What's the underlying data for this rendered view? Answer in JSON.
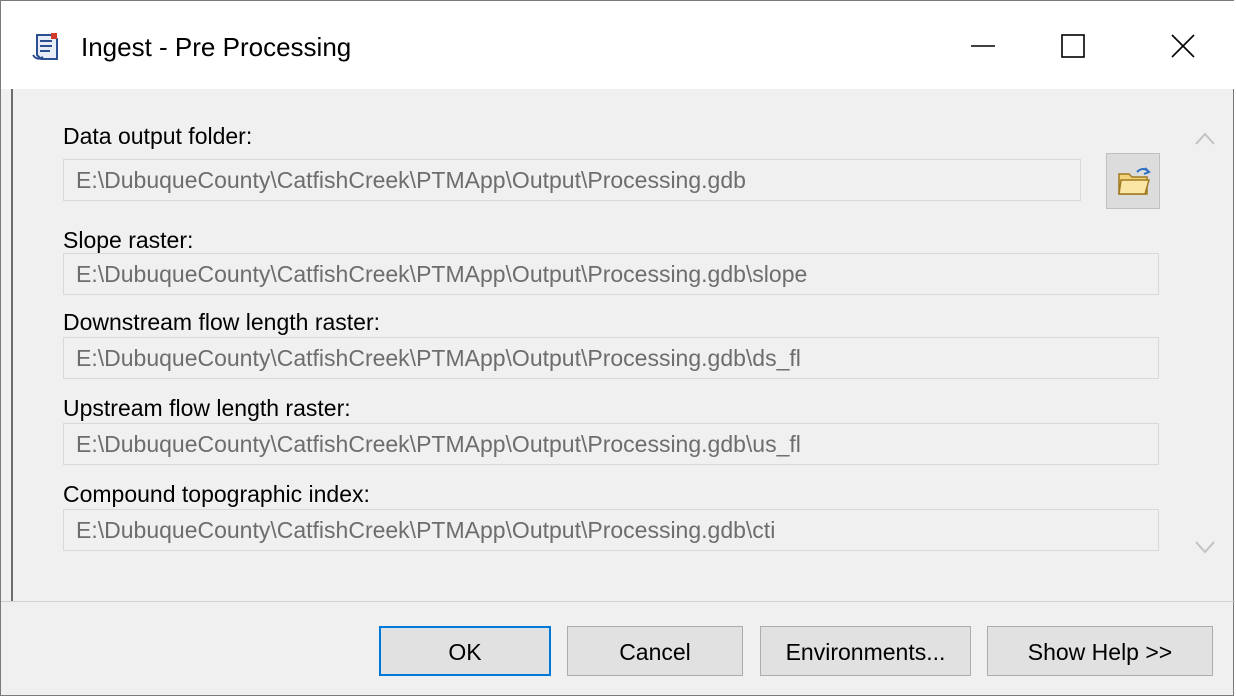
{
  "window": {
    "title": "Ingest - Pre Processing",
    "controls": [
      "minimize-icon",
      "maximize-icon",
      "close-icon"
    ]
  },
  "fields": [
    {
      "label": "Data output folder:",
      "value": "E:\\DubuqueCounty\\CatfishCreek\\PTMApp\\Output\\Processing.gdb"
    },
    {
      "label": "Slope raster:",
      "value": "E:\\DubuqueCounty\\CatfishCreek\\PTMApp\\Output\\Processing.gdb\\slope"
    },
    {
      "label": "Downstream flow length raster:",
      "value": "E:\\DubuqueCounty\\CatfishCreek\\PTMApp\\Output\\Processing.gdb\\ds_fl"
    },
    {
      "label": "Upstream flow length raster:",
      "value": "E:\\DubuqueCounty\\CatfishCreek\\PTMApp\\Output\\Processing.gdb\\us_fl"
    },
    {
      "label": "Compound topographic index:",
      "value": "E:\\DubuqueCounty\\CatfishCreek\\PTMApp\\Output\\Processing.gdb\\cti"
    }
  ],
  "buttons": {
    "ok": "OK",
    "cancel": "Cancel",
    "environments": "Environments...",
    "show_help": "Show Help >>"
  },
  "colors": {
    "accent": "#0078d7",
    "field_text": "#6d6d6d",
    "background": "#f0f0f0"
  }
}
